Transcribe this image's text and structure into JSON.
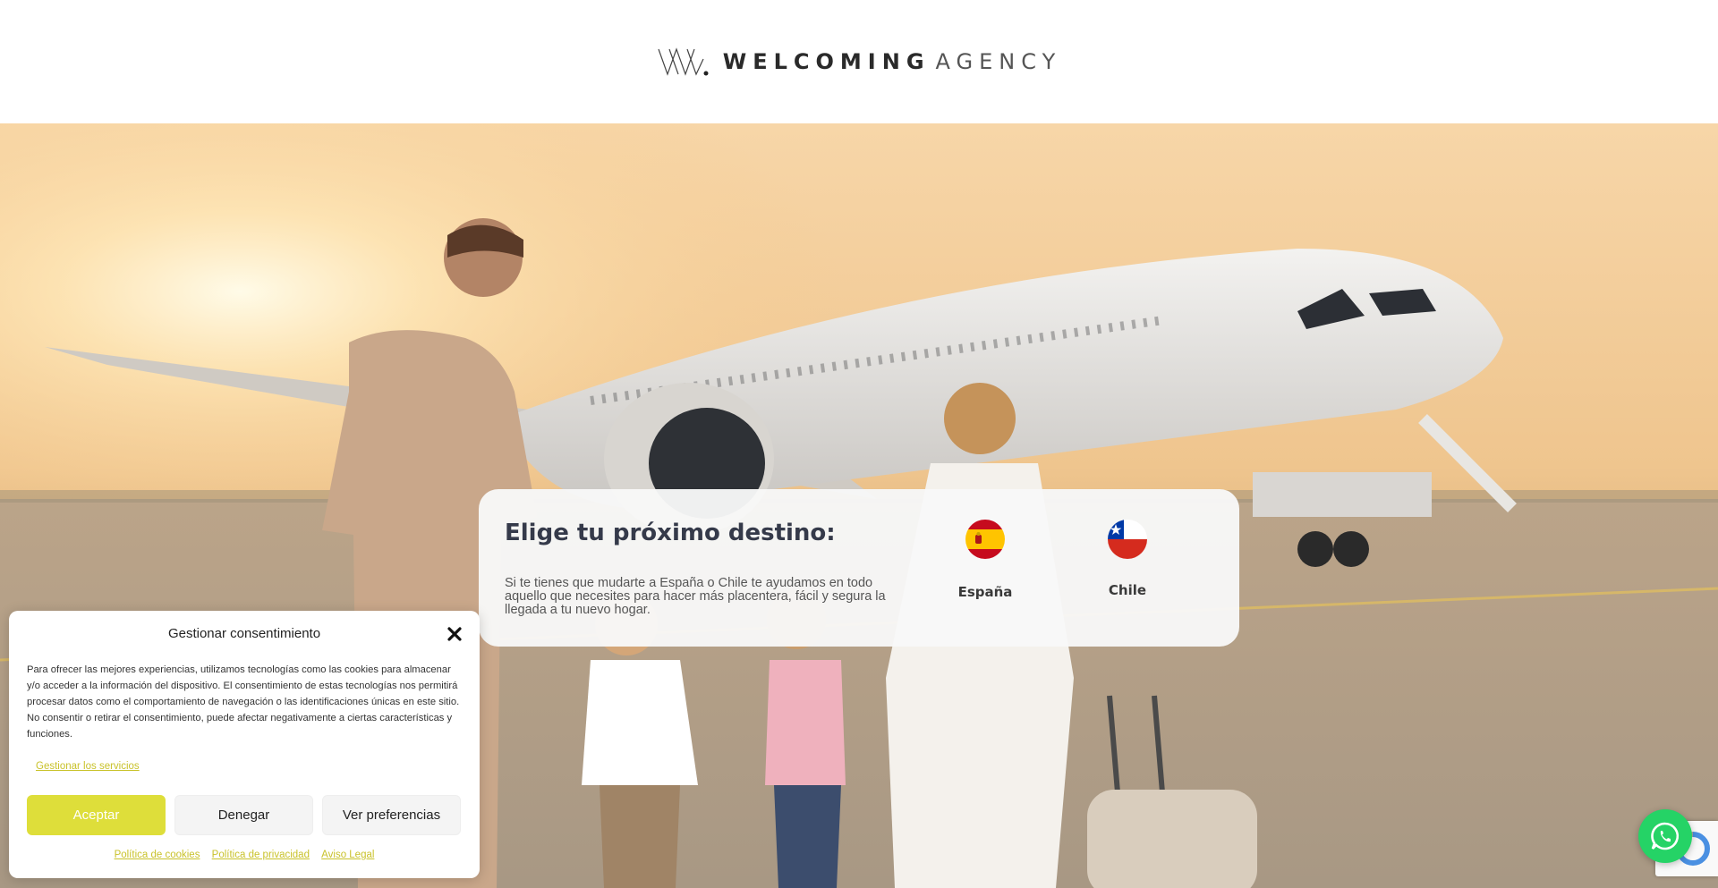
{
  "brand": {
    "name_bold": "WELCOMING",
    "name_light": "AGENCY"
  },
  "destination": {
    "title": "Elige tu próximo destino:",
    "description": "Si te tienes que mudarte a España o Chile te ayudamos en todo aquello que necesites para hacer más placentera, fácil y segura la llegada a tu nuevo hogar.",
    "options": [
      {
        "label": "España",
        "icon": "spain-flag-icon"
      },
      {
        "label": "Chile",
        "icon": "chile-flag-icon"
      }
    ]
  },
  "cookie": {
    "title": "Gestionar consentimiento",
    "body": "Para ofrecer las mejores experiencias, utilizamos tecnologías como las cookies para almacenar y/o acceder a la información del dispositivo. El consentimiento de estas tecnologías nos permitirá procesar datos como el comportamiento de navegación o las identificaciones únicas en este sitio. No consentir o retirar el consentimiento, puede afectar negativamente a ciertas características y funciones.",
    "manage_services": "Gestionar los servicios",
    "buttons": {
      "accept": "Aceptar",
      "deny": "Denegar",
      "preferences": "Ver preferencias"
    },
    "links": {
      "cookies": "Política de cookies",
      "privacy": "Política de privacidad",
      "legal": "Aviso Legal"
    }
  },
  "colors": {
    "accent": "#dede3a",
    "link": "#c9c22a",
    "whatsapp": "#25d366",
    "title": "#353a4a"
  },
  "icons": [
    "logo-mark-icon",
    "close-icon",
    "whatsapp-icon",
    "recaptcha-icon"
  ]
}
